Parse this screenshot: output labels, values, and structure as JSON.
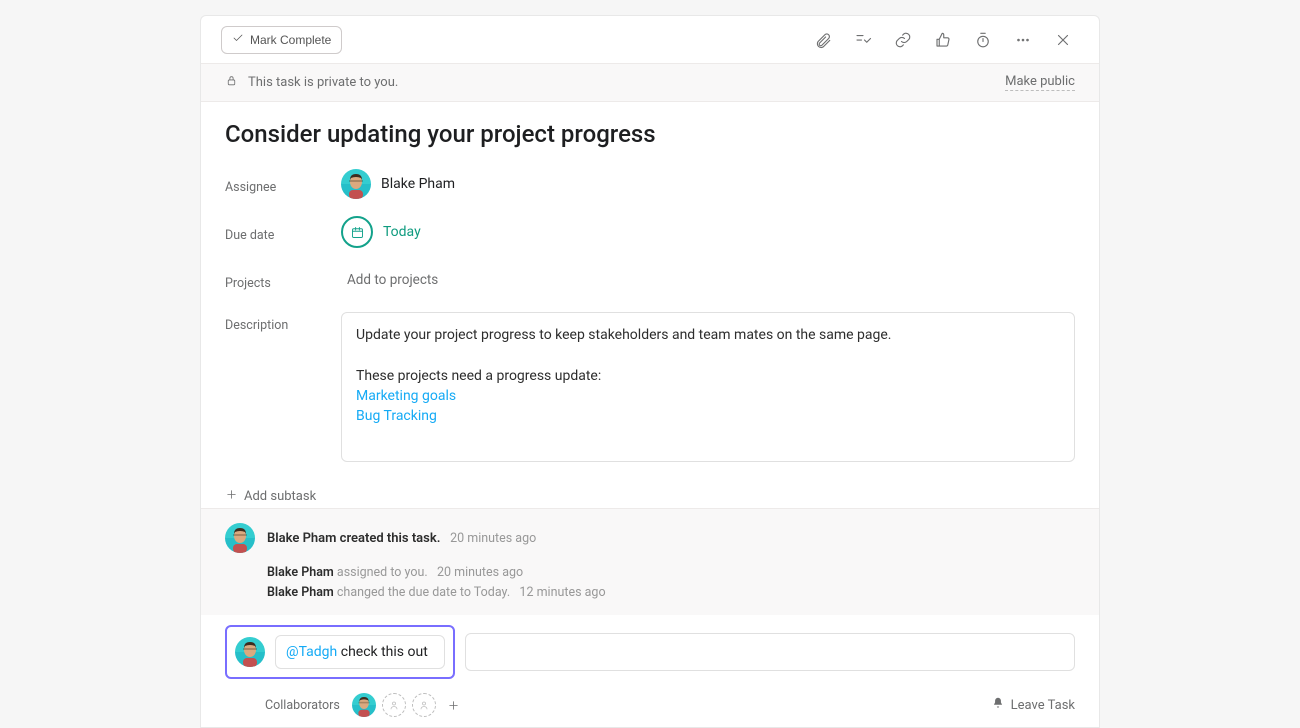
{
  "header": {
    "mark_complete": "Mark Complete"
  },
  "privacy": {
    "message": "This task is private to you.",
    "make_public": "Make public"
  },
  "title": "Consider updating your project progress",
  "fields": {
    "assignee_label": "Assignee",
    "assignee_name": "Blake Pham",
    "due_date_label": "Due date",
    "due_date_value": "Today",
    "projects_label": "Projects",
    "projects_placeholder": "Add to projects",
    "description_label": "Description"
  },
  "description": {
    "line1": "Update your project progress to keep stakeholders and team mates on the same page.",
    "line2": "These projects need a progress update:",
    "link1": "Marketing goals",
    "link2": "Bug Tracking"
  },
  "add_subtask": "Add subtask",
  "activity": {
    "created_by": "Blake Pham created this task.",
    "created_ts": "20 minutes ago",
    "line2_user": "Blake Pham",
    "line2_action": "assigned to you.",
    "line2_ts": "20 minutes ago",
    "line3_user": "Blake Pham",
    "line3_action": "changed the due date to Today.",
    "line3_ts": "12 minutes ago"
  },
  "comment": {
    "mention": "@Tadgh",
    "text": "check this out"
  },
  "footer": {
    "collaborators_label": "Collaborators",
    "leave_task": "Leave Task"
  },
  "colors": {
    "accent_teal": "#14aaf5",
    "success_green": "#0f9b7f",
    "highlight": "#796eff"
  },
  "avatar": {
    "bg_top": "#34cdd0",
    "bg_bottom": "#26bfc9",
    "skin": "#dba97f",
    "hair": "#3d2d1f",
    "shirt": "#c35050"
  }
}
